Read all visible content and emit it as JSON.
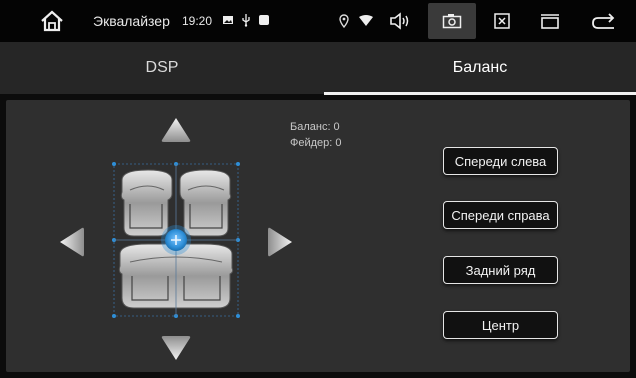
{
  "statusbar": {
    "app_title": "Эквалайзер",
    "clock": "19:20",
    "icons": [
      "home-icon",
      "image-icon",
      "usb-icon",
      "square-icon",
      "location-icon",
      "wifi-icon",
      "volume-icon",
      "screenshot-icon",
      "close-icon",
      "recent-apps-icon",
      "back-icon"
    ]
  },
  "tabs": [
    {
      "label": "DSP",
      "active": false
    },
    {
      "label": "Баланс",
      "active": true
    }
  ],
  "balance": {
    "balance_label": "Баланс: 0",
    "fader_label": "Фейдер: 0"
  },
  "buttons": {
    "front_left": "Спереди слева",
    "front_right": "Спереди справа",
    "rear": "Задний ряд",
    "center": "Центр"
  },
  "colors": {
    "accent": "#2e8fd8",
    "background": "#0c0c0c",
    "panel": "#2f2f2f",
    "tabbar": "#262626"
  }
}
